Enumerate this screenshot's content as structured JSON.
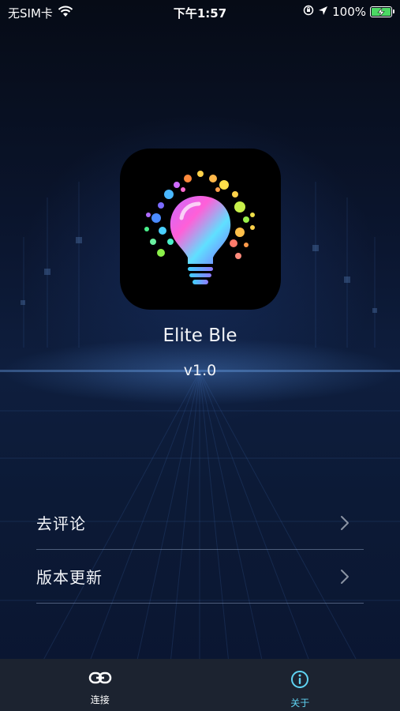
{
  "status_bar": {
    "carrier": "无SIM卡",
    "time": "下午1:57",
    "battery": "100%",
    "battery_level": 1.0
  },
  "app": {
    "name": "Elite Ble",
    "version": "v1.0",
    "icon": "lightbulb-icon"
  },
  "menu": {
    "items": [
      {
        "label": "去评论",
        "icon": "chevron-right-icon"
      },
      {
        "label": "版本更新",
        "icon": "chevron-right-icon"
      }
    ]
  },
  "tab_bar": {
    "tabs": [
      {
        "label": "连接",
        "icon": "link-icon",
        "active": false
      },
      {
        "label": "关于",
        "icon": "info-icon",
        "active": true
      }
    ]
  },
  "colors": {
    "accent": "#5fd3f2",
    "tab_bar_bg": "#1c2330",
    "background": "#0b1428"
  }
}
